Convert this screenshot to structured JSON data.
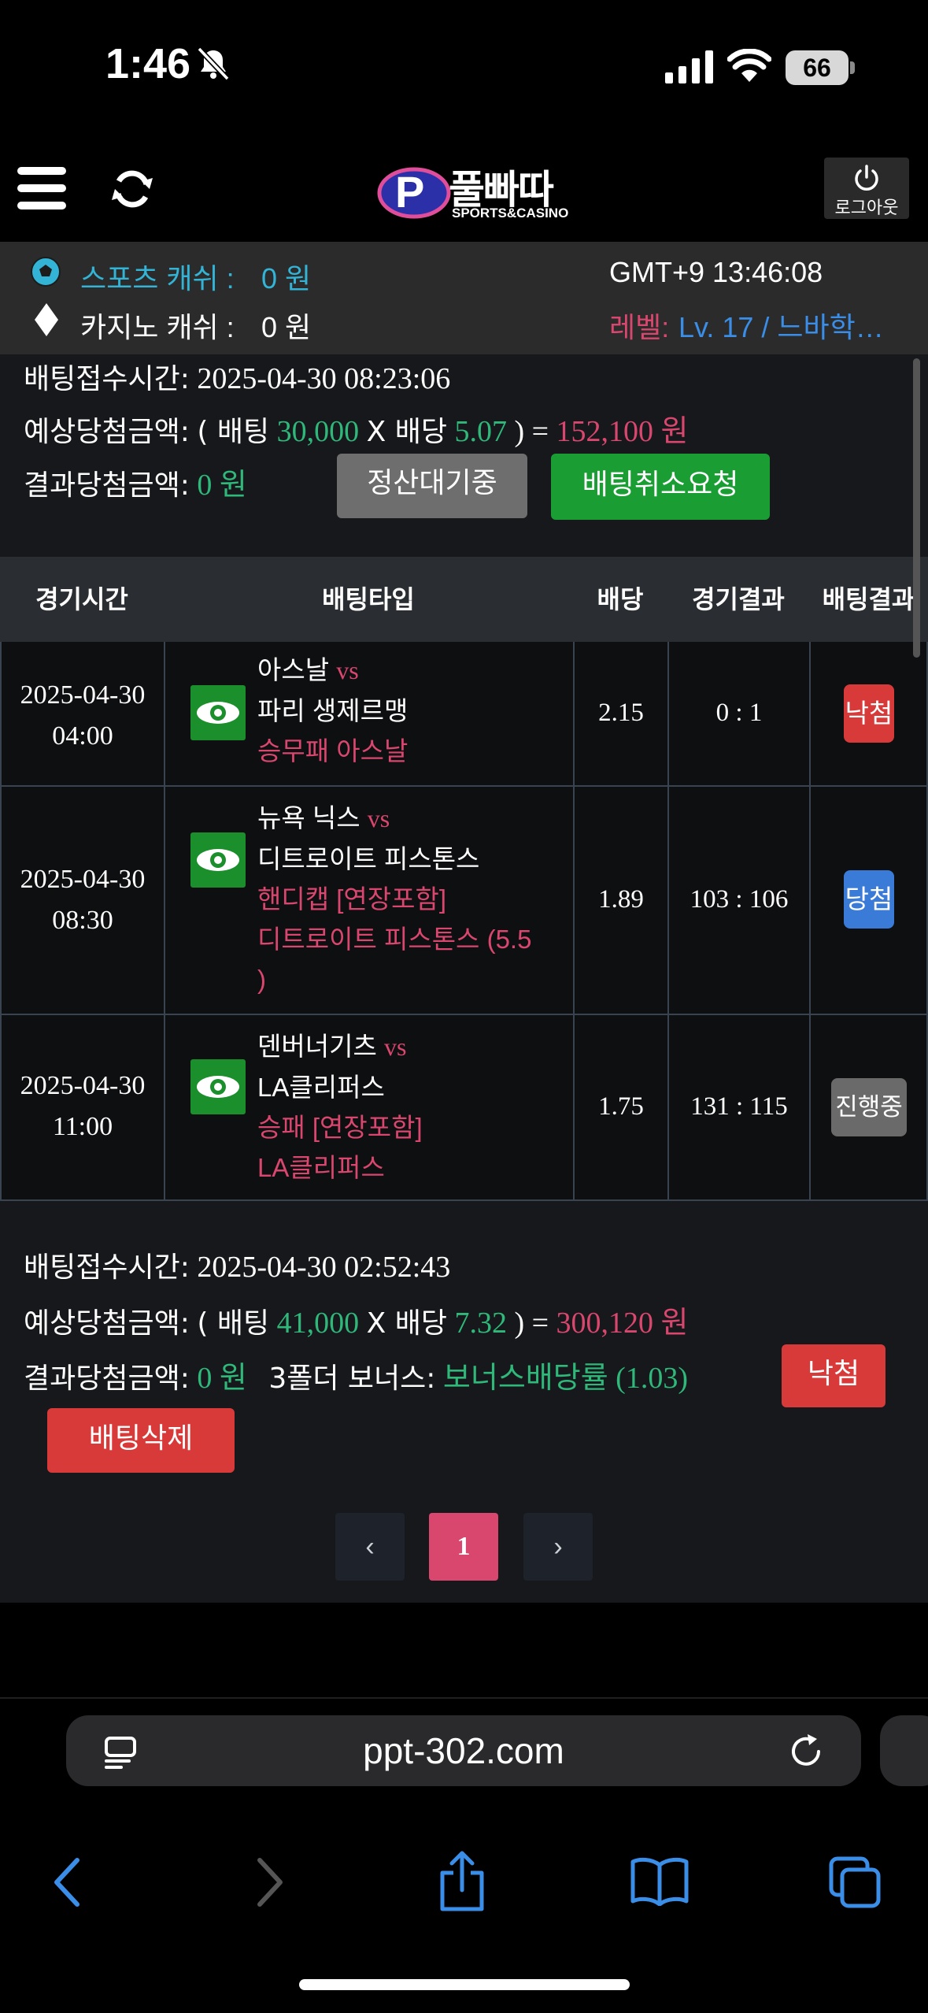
{
  "status_bar": {
    "time": "1:46",
    "battery": "66"
  },
  "header": {
    "logo_text": "풀빠따",
    "logo_sub": "SPORTS&CASINO",
    "logout_label": "로그아웃"
  },
  "info": {
    "sports_cash_label": "스포츠 캐쉬 :",
    "sports_cash_value": "0 원",
    "casino_cash_label": "카지노 캐쉬 :",
    "casino_cash_value": "0 원",
    "clock": "GMT+9 13:46:08",
    "level_label": "레벨:",
    "level_value": "Lv. 17 / 느바학…"
  },
  "bet1": {
    "received_label": "배팅접수시간:",
    "received_time": "2025-04-30 08:23:06",
    "expected_label": "예상당첨금액:",
    "open_paren": "( 배팅",
    "stake": "30,000",
    "x_label": "X 배당",
    "odds": "5.07",
    "close_eq": ") =",
    "payout": "152,100 원",
    "result_label": "결과당첨금액:",
    "result_value": "0 원",
    "status_button": "정산대기중",
    "cancel_button": "배팅취소요청"
  },
  "table": {
    "headers": [
      "경기시간",
      "배팅타입",
      "배당",
      "경기결과",
      "배팅결과"
    ],
    "rows": [
      {
        "date": "2025-04-30",
        "time": "04:00",
        "home": "아스날",
        "vs": "vs",
        "away": "파리 생제르맹",
        "pick1": "승무패 아스날",
        "pick2": "",
        "pick3": "",
        "odds": "2.15",
        "score": "0 : 1",
        "result": "낙첨",
        "result_color": "#d83a3a"
      },
      {
        "date": "2025-04-30",
        "time": "08:30",
        "home": "뉴욕 닉스",
        "vs": "vs",
        "away": "디트로이트 피스톤스",
        "pick1": "핸디캡 [연장포함]",
        "pick2": "디트로이트 피스톤스 (5.5",
        "pick3": ")",
        "odds": "1.89",
        "score": "103 : 106",
        "result": "당첨",
        "result_color": "#3a7bd8"
      },
      {
        "date": "2025-04-30",
        "time": "11:00",
        "home": "덴버너기츠",
        "vs": "vs",
        "away": "LA클리퍼스",
        "pick1": "승패 [연장포함]",
        "pick2": "LA클리퍼스",
        "pick3": "",
        "odds": "1.75",
        "score": "131 : 115",
        "result": "진행중",
        "result_color": "#6a6a6a"
      }
    ]
  },
  "bet2": {
    "received_label": "배팅접수시간:",
    "received_time": "2025-04-30 02:52:43",
    "expected_label": "예상당첨금액:",
    "open_paren": "( 배팅",
    "stake": "41,000",
    "x_label": "X 배당",
    "odds": "7.32",
    "close_eq": ") =",
    "payout": "300,120 원",
    "result_label": "결과당첨금액:",
    "result_value": "0 원",
    "bonus_label": "3폴더 보너스:",
    "bonus_value": "보너스배당률 (1.03)",
    "status_button": "낙첨",
    "delete_button": "배팅삭제"
  },
  "pagination": {
    "prev": "‹",
    "current": "1",
    "next": "›"
  },
  "browser": {
    "url": "ppt-302.com"
  },
  "colors": {
    "accent_green": "#2fb87a",
    "accent_pink": "#d9466e",
    "accent_blue": "#3a8ee8",
    "button_green": "#1a9e34",
    "button_red": "#d83a3a"
  }
}
